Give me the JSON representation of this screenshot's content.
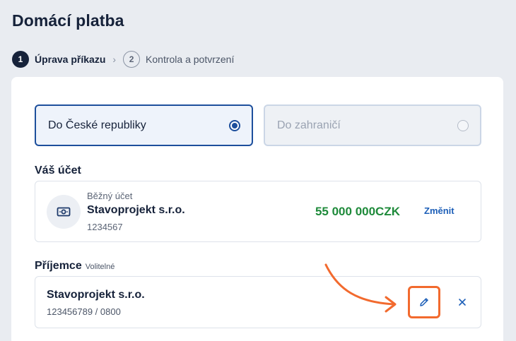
{
  "header": {
    "title": "Domácí platba"
  },
  "stepper": {
    "steps": [
      {
        "number": "1",
        "label": "Úprava příkazu",
        "state": "active"
      },
      {
        "number": "2",
        "label": "Kontrola a potvrzení",
        "state": "inactive"
      }
    ],
    "separator": "›"
  },
  "destination": {
    "options": [
      {
        "label": "Do České republiky",
        "selected": true
      },
      {
        "label": "Do zahraničí",
        "selected": false
      }
    ]
  },
  "account": {
    "section_label": "Váš účet",
    "type": "Běžný účet",
    "name": "Stavoprojekt s.r.o.",
    "number": "1234567",
    "balance": "55 000 000CZK",
    "change_label": "Změnit",
    "icon": "banknote-icon"
  },
  "recipient": {
    "section_label": "Příjemce",
    "optional_hint": "Volitelné",
    "name": "Stavoprojekt s.r.o.",
    "account": "123456789 / 0800",
    "edit_icon": "pencil-icon",
    "remove_icon": "close-icon"
  },
  "colors": {
    "accent": "#1d4f9c",
    "balance": "#1e8a3a",
    "link": "#1d5fb8",
    "highlight": "#f26a2e"
  }
}
